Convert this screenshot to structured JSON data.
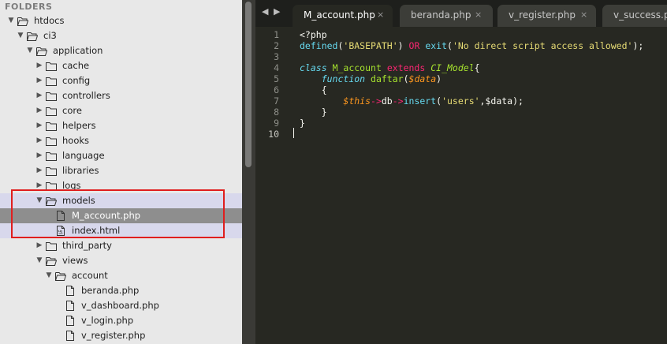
{
  "sidebar": {
    "header": "FOLDERS",
    "items": [
      {
        "label": "htdocs",
        "type": "folder-open",
        "depth": 0
      },
      {
        "label": "ci3",
        "type": "folder-open",
        "depth": 1
      },
      {
        "label": "application",
        "type": "folder-open",
        "depth": 2
      },
      {
        "label": "cache",
        "type": "folder",
        "depth": 3
      },
      {
        "label": "config",
        "type": "folder",
        "depth": 3
      },
      {
        "label": "controllers",
        "type": "folder",
        "depth": 3
      },
      {
        "label": "core",
        "type": "folder",
        "depth": 3
      },
      {
        "label": "helpers",
        "type": "folder",
        "depth": 3
      },
      {
        "label": "hooks",
        "type": "folder",
        "depth": 3
      },
      {
        "label": "language",
        "type": "folder",
        "depth": 3
      },
      {
        "label": "libraries",
        "type": "folder",
        "depth": 3
      },
      {
        "label": "logs",
        "type": "folder",
        "depth": 3
      },
      {
        "label": "models",
        "type": "folder-open",
        "depth": 3
      },
      {
        "label": "M_account.php",
        "type": "file",
        "depth": 4
      },
      {
        "label": "index.html",
        "type": "file-html",
        "depth": 4
      },
      {
        "label": "third_party",
        "type": "folder",
        "depth": 3
      },
      {
        "label": "views",
        "type": "folder-open",
        "depth": 3
      },
      {
        "label": "account",
        "type": "folder-open",
        "depth": 4
      },
      {
        "label": "beranda.php",
        "type": "file",
        "depth": 5
      },
      {
        "label": "v_dashboard.php",
        "type": "file",
        "depth": 5
      },
      {
        "label": "v_login.php",
        "type": "file",
        "depth": 5
      },
      {
        "label": "v_register.php",
        "type": "file",
        "depth": 5
      }
    ]
  },
  "tabs": [
    {
      "label": "M_account.php",
      "close": "×",
      "active": true
    },
    {
      "label": "beranda.php",
      "close": "×",
      "active": false
    },
    {
      "label": "v_register.php",
      "close": "×",
      "active": false
    },
    {
      "label": "v_success.p",
      "close": "",
      "active": false
    }
  ],
  "nav": {
    "back": "◀",
    "forward": "▶"
  },
  "editor": {
    "line_numbers": [
      "1",
      "2",
      "3",
      "4",
      "5",
      "6",
      "7",
      "8",
      "9",
      "10"
    ],
    "lines": [
      "<?php",
      "defined('BASEPATH') OR exit('No direct script access allowed');",
      "",
      "class M_account extends CI_Model{",
      "    function daftar($data)",
      "    {",
      "        $this->db->insert('users',$data);",
      "    }",
      "}",
      ""
    ]
  },
  "colors": {
    "editor_bg": "#272822",
    "sidebar_bg": "#e8e8e8",
    "selected_row": "#8e8e8e",
    "highlight_box": "#e01e1e",
    "keyword": "#66d9ef",
    "string": "#e6db74",
    "operator": "#f92672",
    "class_name": "#a6e22e",
    "variable": "#fd971f"
  }
}
